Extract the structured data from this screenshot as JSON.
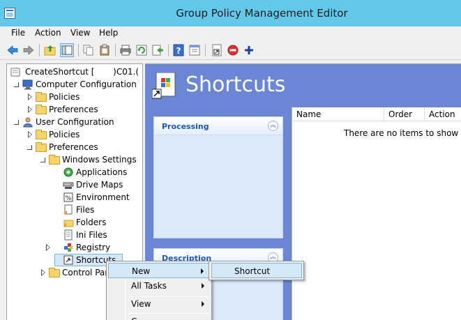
{
  "window": {
    "title": "Group Policy Management Editor"
  },
  "menubar": {
    "items": [
      "File",
      "Action",
      "View",
      "Help"
    ]
  },
  "toolbar": {
    "icons": [
      "back-arrow-icon",
      "forward-arrow-icon",
      "up-folder-icon",
      "show-hide-tree-icon",
      "copy-icon",
      "paste-icon",
      "print-icon",
      "refresh-icon",
      "export-list-icon",
      "help-icon",
      "properties-icon",
      "new-shortcut-icon",
      "stop-icon",
      "add-icon"
    ]
  },
  "tree": {
    "root": "CreateShortcut [       )C01.(",
    "computer_configuration": "Computer Configuration",
    "cc_policies": "Policies",
    "cc_preferences": "Preferences",
    "user_configuration": "User Configuration",
    "uc_policies": "Policies",
    "uc_preferences": "Preferences",
    "windows_settings": "Windows Settings",
    "applications": "Applications",
    "drive_maps": "Drive Maps",
    "environment": "Environment",
    "files": "Files",
    "folders": "Folders",
    "ini_files": "Ini Files",
    "registry": "Registry",
    "shortcuts": "Shortcuts",
    "control_panel": "Control Par"
  },
  "content": {
    "title": "Shortcuts",
    "processing_label": "Processing",
    "description_label": "Description",
    "columns": [
      "Name",
      "Order",
      "Action"
    ],
    "empty_text": "There are no items to show in th"
  },
  "context_menu": {
    "new": "New",
    "all_tasks": "All Tasks",
    "view": "View",
    "cut_off": "C"
  },
  "submenu": {
    "shortcut": "Shortcut"
  },
  "colors": {
    "titlebar": "#62c9ea",
    "content_bg": "#6a86d4",
    "task_panel": "#dbe9fb",
    "menu_highlight": "#d5e8f8"
  }
}
